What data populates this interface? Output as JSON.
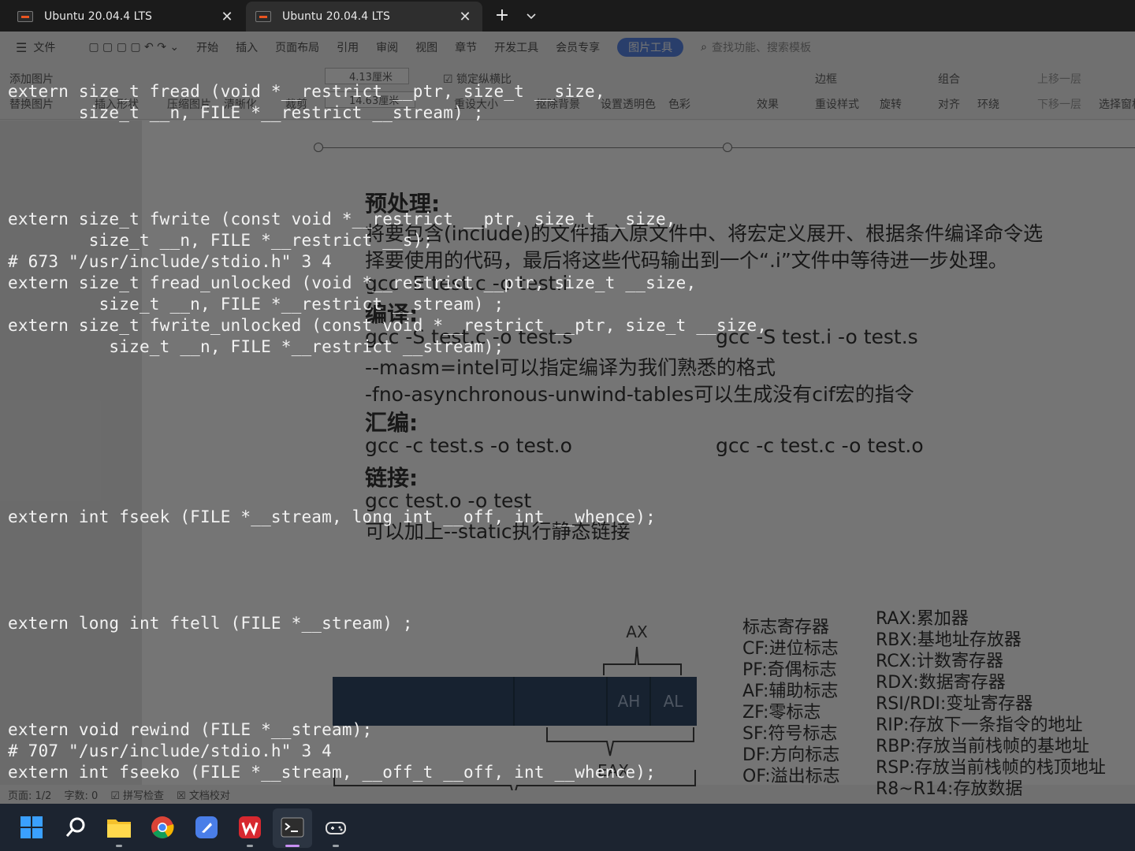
{
  "terminal_tabs": [
    {
      "title": "Ubuntu 20.04.4 LTS",
      "active": false
    },
    {
      "title": "Ubuntu 20.04.4 LTS",
      "active": true
    }
  ],
  "terminal_lines": [
    "extern size_t fread (void *__restrict __ptr, size_t __size,",
    "       size_t __n, FILE *__restrict __stream) ;",
    "extern size_t fwrite (const void *__restrict __ptr, size_t __size,",
    "        size_t __n, FILE *__restrict __s);",
    "# 673 \"/usr/include/stdio.h\" 3 4",
    "extern size_t fread_unlocked (void *__restrict __ptr, size_t __size,",
    "         size_t __n, FILE *__restrict __stream) ;",
    "extern size_t fwrite_unlocked (const void *__restrict __ptr, size_t __size,",
    "          size_t __n, FILE *__restrict __stream);",
    "extern int fseek (FILE *__stream, long int __off, int __whence);",
    "extern long int ftell (FILE *__stream) ;",
    "extern void rewind (FILE *__stream);",
    "# 707 \"/usr/include/stdio.h\" 3 4",
    "extern int fseeko (FILE *__stream, __off_t __off, int __whence);"
  ],
  "wps": {
    "menu": [
      "文件",
      "开始",
      "插入",
      "页面布局",
      "引用",
      "审阅",
      "视图",
      "章节",
      "开发工具",
      "会员专享",
      "图片工具"
    ],
    "search_placeholder": "查找功能、搜索模板",
    "ribbon": {
      "add_picture": "添加图片",
      "replace_picture": "替换图片",
      "insert_shape": "插入形状",
      "compress_picture": "压缩图片",
      "sharpen": "清晰化",
      "crop": "裁剪",
      "width": "4.13厘米",
      "height": "14.63厘米",
      "lock_ratio": "锁定纵横比",
      "reset_size": "重设大小",
      "remove_bg": "抠除背景",
      "set_transparent": "设置透明色",
      "color": "色彩",
      "effects": "效果",
      "border": "边框",
      "reset_style": "重设样式",
      "rotate": "旋转",
      "group": "组合",
      "align": "对齐",
      "wrap": "环绕",
      "bring_forward": "上移一层",
      "send_backward": "下移一层",
      "selection_pane": "选择窗格"
    },
    "doc": {
      "preprocess_heading": "预处理:",
      "preprocess_text_1": "将要包含(include)的文件插入原文件中、将宏定义展开、根据条件编译命令选",
      "preprocess_text_2": "择要使用的代码，最后将这些代码输出到一个“.i”文件中等待进一步处理。",
      "preprocess_cmd": "gcc -E test.c -o test.i",
      "compile_heading": "编译:",
      "compile_cmd_1": "gcc -S test.c -o test.s",
      "compile_cmd_2": "gcc -S test.i -o test.s",
      "compile_note_1": "--masm=intel可以指定编译为我们熟悉的格式",
      "compile_note_2": "-fno-asynchronous-unwind-tables可以生成没有cif宏的指令",
      "assemble_heading": "汇编:",
      "assemble_cmd_1": "gcc -c test.s -o test.o",
      "assemble_cmd_2": "gcc -c test.c -o test.o",
      "link_heading": "链接:",
      "link_cmd": "gcc test.o -o test",
      "link_note": "可以加上--static执行静态链接",
      "register_labels": {
        "ax": "AX",
        "ah": "AH",
        "al": "AL",
        "eax": "EAX"
      },
      "flags": [
        "标志寄存器",
        "CF:进位标志",
        "PF:奇偶标志",
        "AF:辅助标志",
        "ZF:零标志",
        "SF:符号标志",
        "DF:方向标志",
        "OF:溢出标志"
      ],
      "registers": [
        "RAX:累加器",
        "RBX:基地址存放器",
        "RCX:计数寄存器",
        "RDX:数据寄存器",
        "RSI/RDI:变址寄存器",
        "RIP:存放下一条指令的地址",
        "RBP:存放当前栈帧的基地址",
        "RSP:存放当前栈帧的栈顶地址",
        "R8~R14:存放数据"
      ]
    },
    "status": {
      "page": "页面: 1/2",
      "words": "字数: 0",
      "spell": "拼写检查",
      "proof": "文档校对"
    }
  },
  "colors": {
    "register_box": "#1f3a5c",
    "terminal_bg": "#121212",
    "accent": "#4a7ce6"
  }
}
